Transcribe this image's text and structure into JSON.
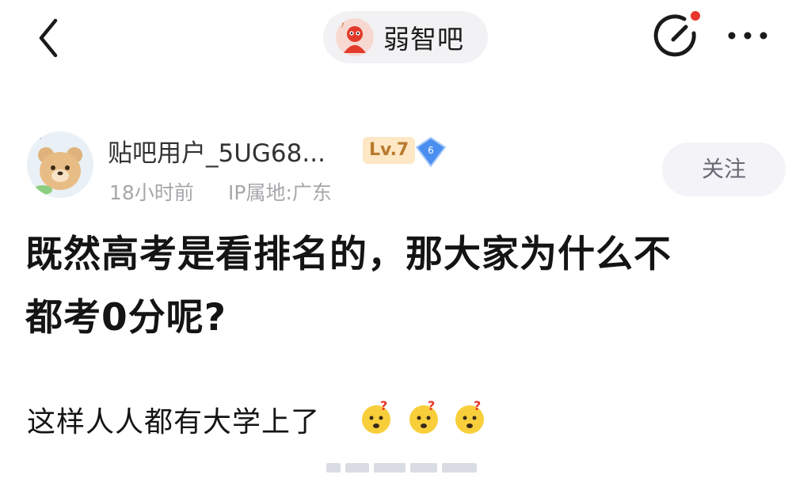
{
  "header": {
    "back_icon": "chevron-left-icon",
    "forum_name": "弱智吧",
    "forum_avatar_icon": "forum-logo-icon",
    "compose_icon": "compose-icon",
    "more_icon": "more-dots-icon"
  },
  "post": {
    "author": {
      "name": "贴吧用户_5UG68...",
      "level": "Lv.7",
      "badge_number": "6",
      "avatar_icon": "bear-avatar-icon"
    },
    "time": "18小时前",
    "ip": "IP属地:广东",
    "follow_label": "关注",
    "title_line1": "既然高考是看排名的，那大家为什么不",
    "title_line2": "都考0分呢?",
    "body": "这样人人都有大学上了",
    "emoji_icon": "thinking-emoji-icon"
  },
  "colors": {
    "accent_red": "#e8362c",
    "level_bg": "#fde7c4",
    "badge_blue": "#4a8ff0",
    "pill_bg": "#f2f2f4"
  }
}
